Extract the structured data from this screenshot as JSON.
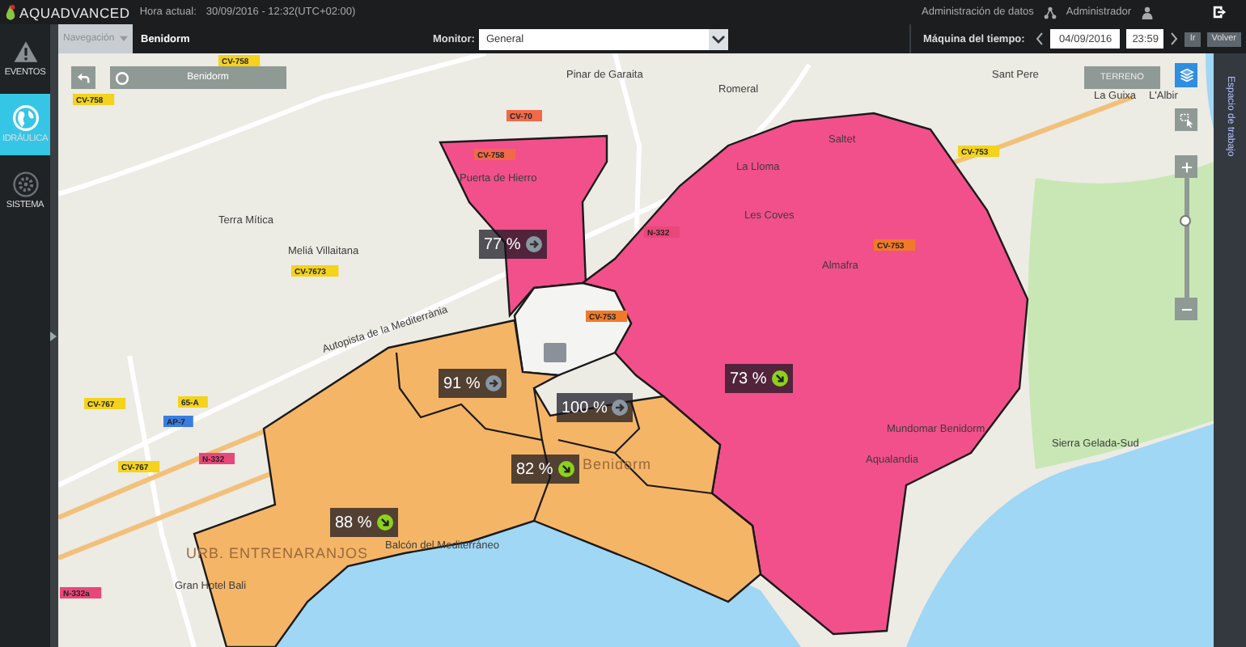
{
  "header": {
    "logo": "AQUADVANCED",
    "time_label": "Hora actual:",
    "time_value": "30/09/2016 - 12:32(UTC+02:00)",
    "data_admin": "Administración de datos",
    "user": "Administrador"
  },
  "sidebar": {
    "items": [
      {
        "label": "EVENTOS",
        "kind": "warning",
        "selected": false
      },
      {
        "label": "IDRÁULICA",
        "kind": "globe",
        "selected": true
      },
      {
        "label": "SISTEMA",
        "kind": "gear",
        "selected": false
      }
    ]
  },
  "toolbar": {
    "navigation": "Navegación",
    "location": "Benidorm",
    "monitor_label": "Monitor:",
    "monitor_value": "General",
    "time_machine_label": "Máquina del tiempo:",
    "date": "04/09/2016",
    "time": "23:59",
    "go_button": "Ir",
    "back_button": "Volver"
  },
  "map": {
    "search_text": "Benidorm",
    "terrain_button": "TERRENO",
    "zoom": {
      "level": 0.65
    },
    "zones": [
      {
        "color": "#f2508a"
      },
      {
        "color": "#f2508a"
      },
      {
        "color": "#f4f4f2"
      },
      {
        "color": "#f5b566"
      }
    ],
    "badges": [
      {
        "value": "77 %",
        "kind": "steady"
      },
      {
        "value": "91 %",
        "kind": "steady"
      },
      {
        "value": "100 %",
        "kind": "steady"
      },
      {
        "value": "82 %",
        "kind": "down"
      },
      {
        "value": "73 %",
        "kind": "down"
      },
      {
        "value": "88 %",
        "kind": "down"
      }
    ],
    "places": [
      "Pinar de Garaita",
      "Romeral",
      "Sant Pere",
      "La Guixa",
      "L'Albir",
      "Terra Mítica",
      "Meliá Villaitana",
      "Puerta de Hierro",
      "La Lloma",
      "Saltet",
      "Les Coves",
      "Almafra",
      "Benidorm",
      "Mundomar Benidorm",
      "Aqualandia",
      "Sierra Gelada-Sud",
      "Balcón del Mediterráneo",
      "URB. ENTRENARANJOS",
      "Gran Hotel Bali",
      "Autopista de la Mediterrània"
    ],
    "roads": [
      {
        "label": "CV-758",
        "color": "#f3d31c"
      },
      {
        "label": "CV-758",
        "color": "#f3d31c"
      },
      {
        "label": "CV-70",
        "color": "#f06a4a"
      },
      {
        "label": "CV-758",
        "color": "#f06a4a"
      },
      {
        "label": "CV-7673",
        "color": "#f3d31c"
      },
      {
        "label": "CV-767",
        "color": "#f3d31c"
      },
      {
        "label": "65-A",
        "color": "#f3d31c"
      },
      {
        "label": "AP-7",
        "color": "#3a7de0"
      },
      {
        "label": "CV-767",
        "color": "#f3d31c"
      },
      {
        "label": "N-332",
        "color": "#e8477a"
      },
      {
        "label": "N-332a",
        "color": "#e8477a"
      },
      {
        "label": "N-332",
        "color": "#e8477a"
      },
      {
        "label": "CV-753",
        "color": "#f07a2a"
      },
      {
        "label": "CV-753",
        "color": "#f07a2a"
      },
      {
        "label": "CV-753",
        "color": "#f3d31c"
      }
    ]
  },
  "side_panel": {
    "title": "Espacio de trabajo"
  }
}
